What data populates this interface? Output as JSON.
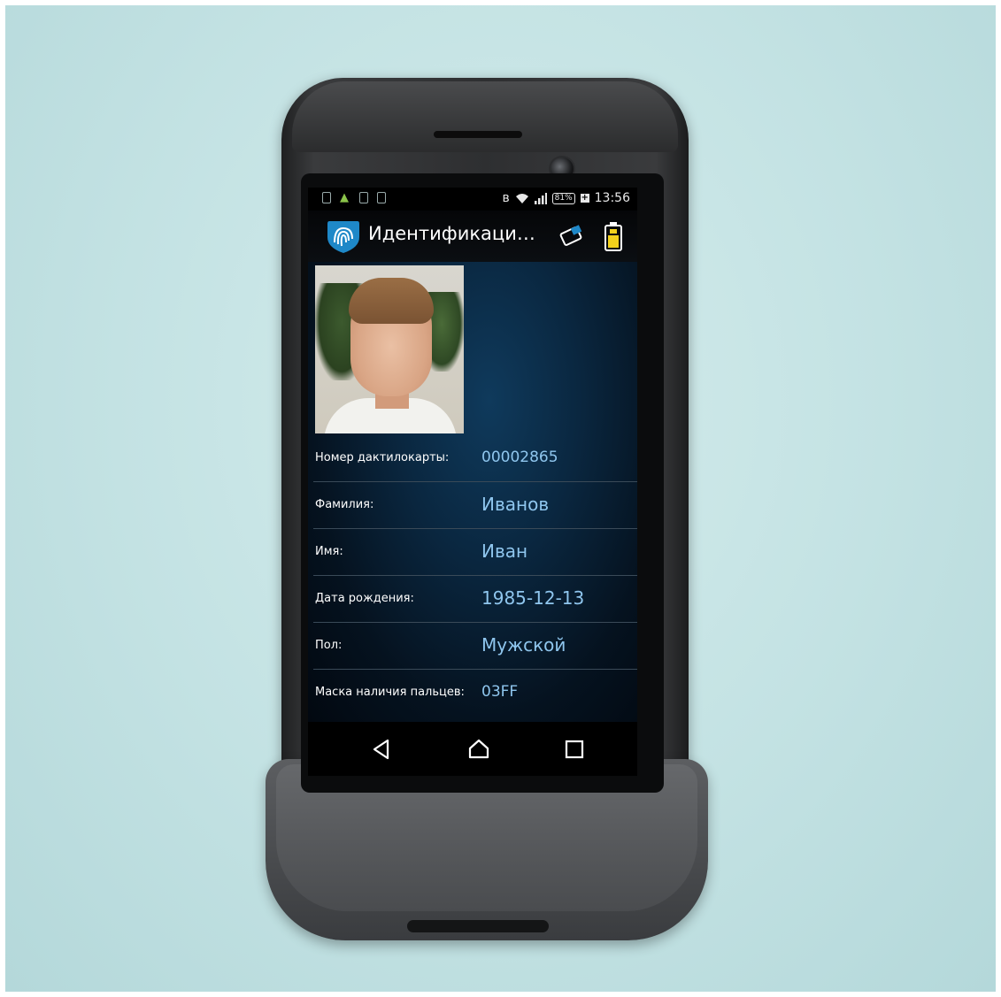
{
  "status_bar": {
    "battery_percent": "81%",
    "time": "13:56"
  },
  "action_bar": {
    "title": "Идентификация че..."
  },
  "record": {
    "fields": [
      {
        "label": "Номер дактилокарты:",
        "value": "00002865"
      },
      {
        "label": "Фамилия:",
        "value": "Иванов"
      },
      {
        "label": "Имя:",
        "value": "Иван"
      },
      {
        "label": "Дата рождения:",
        "value": "1985-12-13"
      },
      {
        "label": "Пол:",
        "value": "Мужской"
      },
      {
        "label": "Маска наличия пальцев:",
        "value": "03FF"
      }
    ]
  },
  "colors": {
    "accent_value": "#8fc6ee",
    "logo_blue": "#1e88c8",
    "battery_yellow": "#f4d21c"
  },
  "icons": {
    "logo": "fingerprint-shield-icon",
    "card": "card-reader-icon",
    "battery": "battery-icon",
    "back": "back-icon",
    "home": "home-icon",
    "recents": "recents-icon"
  }
}
